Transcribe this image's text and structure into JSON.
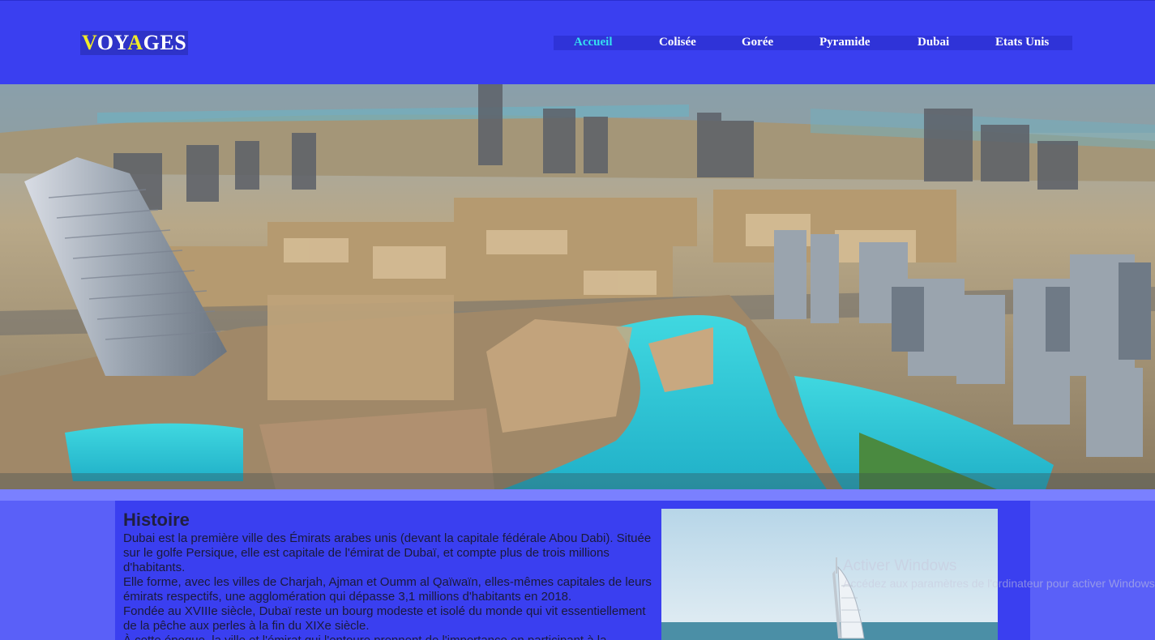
{
  "header": {
    "logo": {
      "part1": "V",
      "part2": "O",
      "part3": "Y",
      "part4": "A",
      "part5": "GES"
    },
    "nav": [
      {
        "label": "Accueil"
      },
      {
        "label": "Colisée"
      },
      {
        "label": "Gorée"
      },
      {
        "label": "Pyramide"
      },
      {
        "label": "Dubai"
      },
      {
        "label": "Etats Unis"
      }
    ]
  },
  "section": {
    "title": "Histoire",
    "paragraphs": [
      "Dubai est la première ville des Émirats arabes unis (devant la capitale fédérale Abou Dabi). Située sur le golfe Persique, elle est capitale de l'émirat de Dubaï, et compte plus de trois millions d'habitants.",
      "Elle forme, avec les villes de Charjah, Ajman et Oumm al Qaïwaïn, elles-mêmes capitales de leurs émirats respectifs, une agglomération qui dépasse 3,1 millions d'habitants en 2018.",
      "Fondée au XVIIIe siècle, Dubaï reste un bourg modeste et isolé du monde qui vit essentiellement de la pêche aux perles à la fin du XIXe siècle.",
      "À cette époque, la ville et l'émirat qui l'entoure prennent de l'importance en participant à la"
    ]
  },
  "watermark": {
    "line1": "Activer Windows",
    "line2": "Accédez aux paramètres de l'ordinateur pour activer Windows."
  },
  "colors": {
    "header_bg": "#3a3ff0",
    "page_bg": "#5a60f8",
    "logo_accent": "#f0ea28",
    "nav_active": "#35e0f0"
  }
}
